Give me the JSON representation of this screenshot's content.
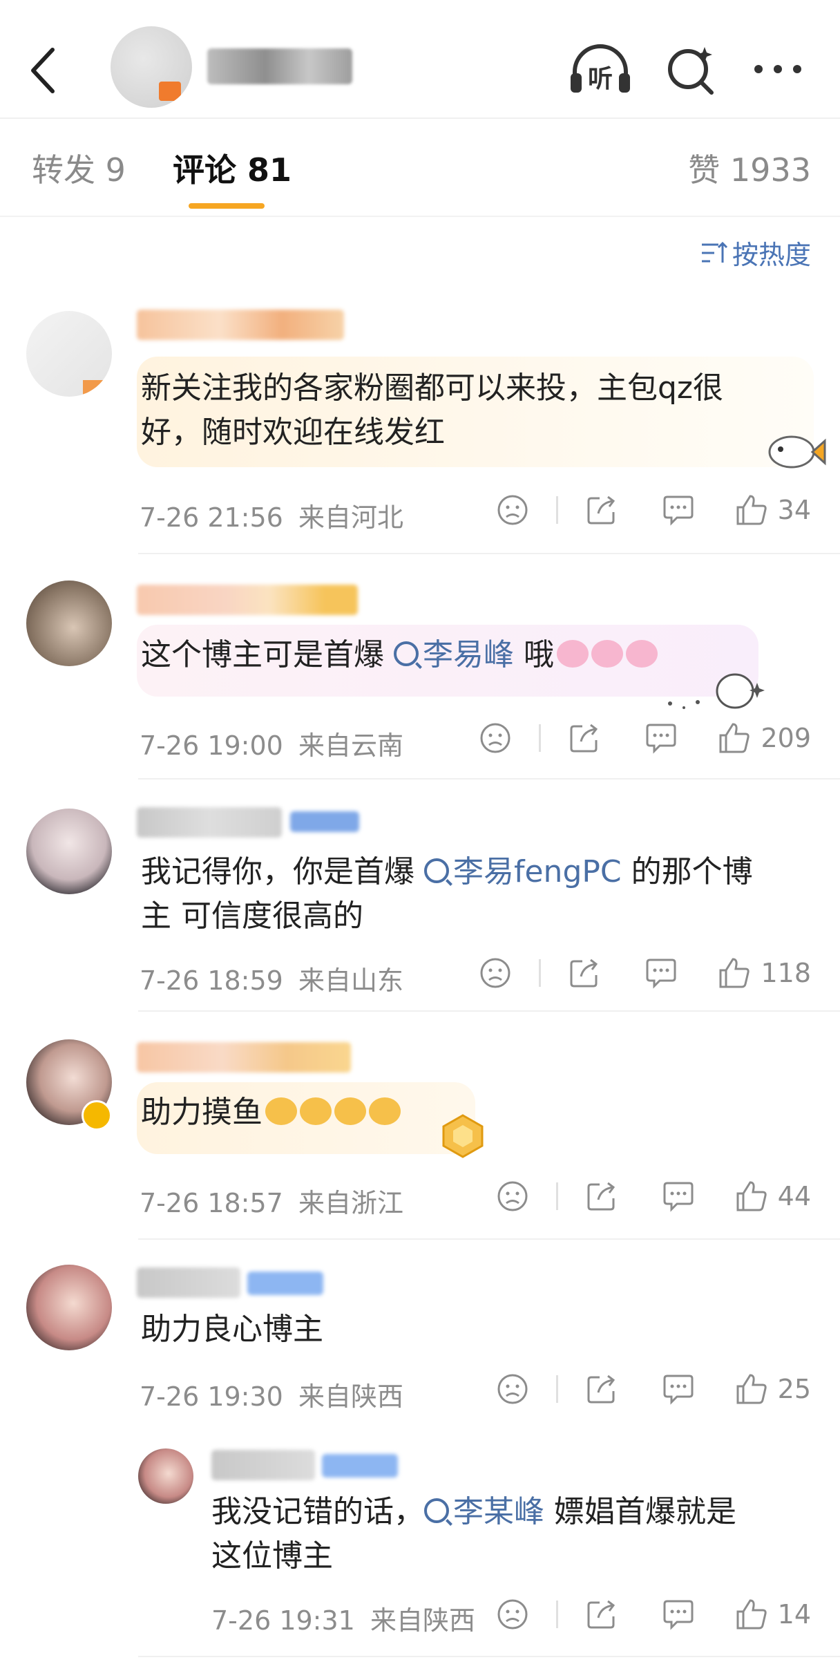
{
  "header": {
    "icons": [
      "back-icon",
      "listen-icon",
      "search-icon",
      "more-icon"
    ]
  },
  "tabs": {
    "repost": "转发 9",
    "comments": "评论 81",
    "likes": "赞 1933"
  },
  "sort_label": "按热度",
  "comments": [
    {
      "text": "新关注我的各家粉圈都可以来投，主包qz很好，随时欢迎在线发红",
      "line1": "新关注我的各家粉圈都可以来投，主包qz很",
      "line2": "好，随时欢迎在线发红",
      "time": "7-26 21:56",
      "location": "来自河北",
      "likes": "34"
    },
    {
      "pre": "这个博主可是首爆",
      "mention": "李易峰",
      "post": "哦",
      "time": "7-26 19:00",
      "location": "来自云南",
      "likes": "209"
    },
    {
      "pre": "我记得你，你是首爆",
      "mention": "李易fengPC",
      "post": "的那个博",
      "line2": "主 可信度很高的",
      "time": "7-26 18:59",
      "location": "来自山东",
      "likes": "118"
    },
    {
      "text": "助力摸鱼",
      "time": "7-26 18:57",
      "location": "来自浙江",
      "likes": "44"
    },
    {
      "text": "助力良心博主",
      "time": "7-26 19:30",
      "location": "来自陕西",
      "likes": "25"
    }
  ],
  "reply": {
    "pre": "我没记错的话，",
    "mention": "李某峰",
    "post": "嫖娼首爆就是",
    "line2": "这位博主",
    "time": "7-26 19:31",
    "location": "来自陕西",
    "likes": "14"
  }
}
